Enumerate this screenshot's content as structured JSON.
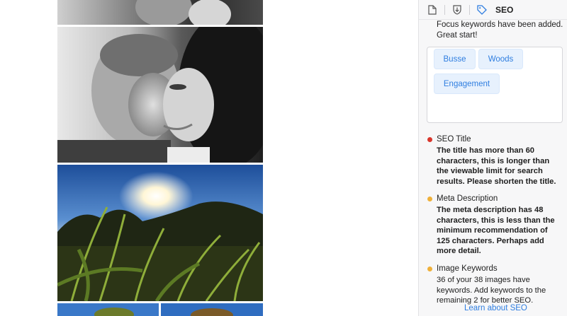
{
  "panel": {
    "tabs": [
      {
        "name": "page-tab",
        "icon": "document-icon"
      },
      {
        "name": "import-tab",
        "icon": "download-shield-icon"
      },
      {
        "name": "seo-tab",
        "icon": "tag-icon",
        "label": "SEO"
      }
    ],
    "intro": "Focus keywords have been added. Great start!",
    "keywords": [
      "Busse",
      "Woods",
      "Engagement"
    ],
    "checks": [
      {
        "title": "SEO Title",
        "status": "error",
        "color": "#d9362b",
        "body": "The title has more than 60 characters, this is longer than the viewable limit for search results. Please shorten the title.",
        "bold": true
      },
      {
        "title": "Meta Description",
        "status": "warning",
        "color": "#efb03a",
        "body": "The meta description has 48 characters, this is less than the minimum recommendation of 125 characters. Perhaps add more detail.",
        "bold": true
      },
      {
        "title": "Image Keywords",
        "status": "warning",
        "color": "#efb03a",
        "body": "36 of your 38 images have keywords. Add keywords to the remaining 2 for better SEO.",
        "bold": false
      }
    ],
    "learn_more": "Learn about SEO"
  },
  "colors": {
    "accent": "#2f7ee0",
    "chip_bg": "#e7f1fd",
    "error": "#d9362b",
    "warning": "#efb03a"
  }
}
